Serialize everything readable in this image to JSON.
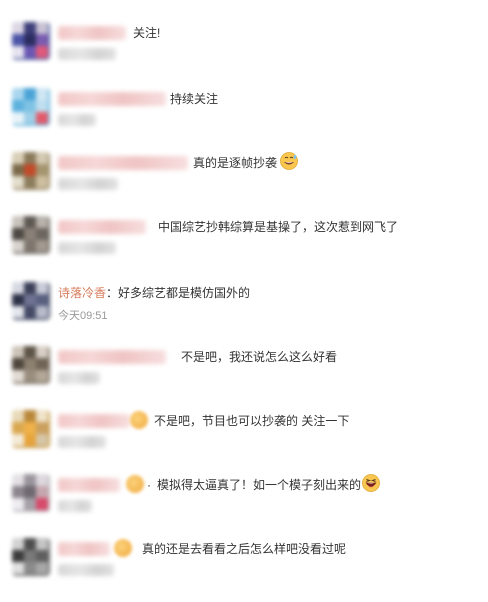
{
  "comments": [
    {
      "text": "关注!"
    },
    {
      "text": "持续关注"
    },
    {
      "text": "真的是逐帧抄袭"
    },
    {
      "text": "中国综艺抄韩综算是基操了，这次惹到网飞了"
    },
    {
      "username": "诗落冷香",
      "separator": "：",
      "text": "好多综艺都是模仿国外的",
      "time": "今天09:51"
    },
    {
      "text": "不是吧，我还说怎么这么好看"
    },
    {
      "text": "不是吧，节目也可以抄袭的 关注一下"
    },
    {
      "text": "模拟得太逼真了！如一个模子刻出来的"
    },
    {
      "text": "真的还是去看看之后怎么样吧没看过呢"
    }
  ],
  "icons": {
    "laugh": "grinning-sweat-emoji",
    "laugh2": "laughing-emoji"
  },
  "colors": {
    "username": "#d77b5a",
    "time": "#999999",
    "text": "#333333"
  }
}
